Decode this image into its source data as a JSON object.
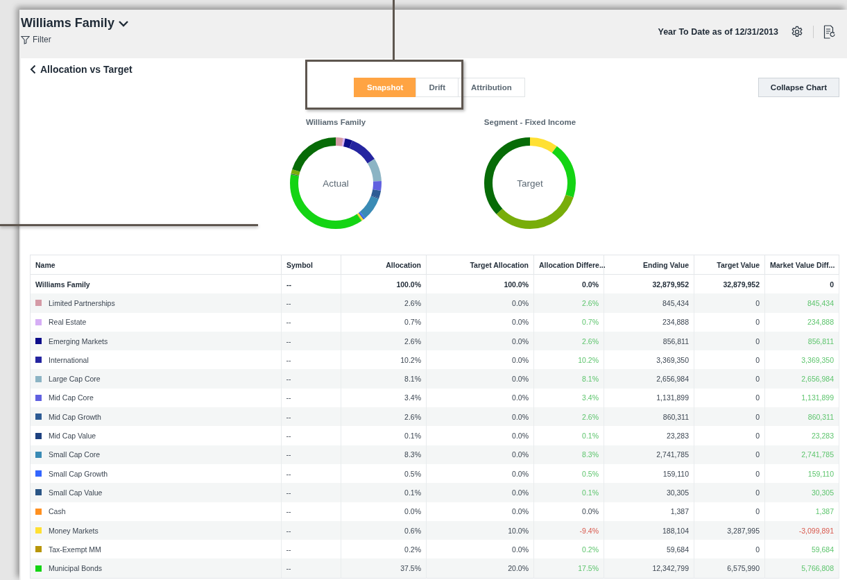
{
  "header": {
    "title": "Williams Family",
    "filter": "Filter",
    "period": "Year To Date as of 12/31/2013"
  },
  "panel": {
    "back": "Allocation vs Target",
    "collapse": "Collapse Chart"
  },
  "tabs": [
    {
      "label": "Snapshot",
      "selected": true
    },
    {
      "label": "Drift",
      "selected": false
    },
    {
      "label": "Attribution",
      "selected": false
    }
  ],
  "donuts": [
    {
      "title": "Williams Family",
      "center": "Actual"
    },
    {
      "title": "Segment - Fixed Income",
      "center": "Target"
    }
  ],
  "table": {
    "columns": [
      "Name",
      "Symbol",
      "Allocation",
      "Target Allocation",
      "Allocation Differe...",
      "Ending Value",
      "Target Value",
      "Market Value Diff..."
    ],
    "total": {
      "name": "Williams Family",
      "symbol": "--",
      "allocation": "100.0%",
      "target_allocation": "100.0%",
      "allocation_diff": "0.0%",
      "ending_value": "32,879,952",
      "target_value": "32,879,952",
      "market_value_diff": "0"
    },
    "rows": [
      {
        "name": "Limited Partnerships",
        "color": "#d49aa6",
        "symbol": "--",
        "allocation": "2.6%",
        "target_allocation": "0.0%",
        "allocation_diff": "2.6%",
        "diff_gain": true,
        "diff_loss": false,
        "ending_value": "845,434",
        "target_value": "0",
        "market_value_diff": "845,434",
        "mv_gain": true,
        "mv_loss": false
      },
      {
        "name": "Real Estate",
        "color": "#d6aef5",
        "symbol": "--",
        "allocation": "0.7%",
        "target_allocation": "0.0%",
        "allocation_diff": "0.7%",
        "diff_gain": true,
        "diff_loss": false,
        "ending_value": "234,888",
        "target_value": "0",
        "market_value_diff": "234,888",
        "mv_gain": true,
        "mv_loss": false
      },
      {
        "name": "Emerging Markets",
        "color": "#0d0d8a",
        "symbol": "--",
        "allocation": "2.6%",
        "target_allocation": "0.0%",
        "allocation_diff": "2.6%",
        "diff_gain": true,
        "diff_loss": false,
        "ending_value": "856,811",
        "target_value": "0",
        "market_value_diff": "856,811",
        "mv_gain": true,
        "mv_loss": false
      },
      {
        "name": "International",
        "color": "#2525a0",
        "symbol": "--",
        "allocation": "10.2%",
        "target_allocation": "0.0%",
        "allocation_diff": "10.2%",
        "diff_gain": true,
        "diff_loss": false,
        "ending_value": "3,369,350",
        "target_value": "0",
        "market_value_diff": "3,369,350",
        "mv_gain": true,
        "mv_loss": false
      },
      {
        "name": "Large Cap Core",
        "color": "#8cb4c4",
        "symbol": "--",
        "allocation": "8.1%",
        "target_allocation": "0.0%",
        "allocation_diff": "8.1%",
        "diff_gain": true,
        "diff_loss": false,
        "ending_value": "2,656,984",
        "target_value": "0",
        "market_value_diff": "2,656,984",
        "mv_gain": true,
        "mv_loss": false
      },
      {
        "name": "Mid Cap Core",
        "color": "#6161e0",
        "symbol": "--",
        "allocation": "3.4%",
        "target_allocation": "0.0%",
        "allocation_diff": "3.4%",
        "diff_gain": true,
        "diff_loss": false,
        "ending_value": "1,131,899",
        "target_value": "0",
        "market_value_diff": "1,131,899",
        "mv_gain": true,
        "mv_loss": false
      },
      {
        "name": "Mid Cap Growth",
        "color": "#2d5b94",
        "symbol": "--",
        "allocation": "2.6%",
        "target_allocation": "0.0%",
        "allocation_diff": "2.6%",
        "diff_gain": true,
        "diff_loss": false,
        "ending_value": "860,311",
        "target_value": "0",
        "market_value_diff": "860,311",
        "mv_gain": true,
        "mv_loss": false
      },
      {
        "name": "Mid Cap Value",
        "color": "#1e4280",
        "symbol": "--",
        "allocation": "0.1%",
        "target_allocation": "0.0%",
        "allocation_diff": "0.1%",
        "diff_gain": true,
        "diff_loss": false,
        "ending_value": "23,283",
        "target_value": "0",
        "market_value_diff": "23,283",
        "mv_gain": true,
        "mv_loss": false
      },
      {
        "name": "Small Cap Core",
        "color": "#3a8bb5",
        "symbol": "--",
        "allocation": "8.3%",
        "target_allocation": "0.0%",
        "allocation_diff": "8.3%",
        "diff_gain": true,
        "diff_loss": false,
        "ending_value": "2,741,785",
        "target_value": "0",
        "market_value_diff": "2,741,785",
        "mv_gain": true,
        "mv_loss": false
      },
      {
        "name": "Small Cap Growth",
        "color": "#3366ff",
        "symbol": "--",
        "allocation": "0.5%",
        "target_allocation": "0.0%",
        "allocation_diff": "0.5%",
        "diff_gain": true,
        "diff_loss": false,
        "ending_value": "159,110",
        "target_value": "0",
        "market_value_diff": "159,110",
        "mv_gain": true,
        "mv_loss": false
      },
      {
        "name": "Small Cap Value",
        "color": "#2a5585",
        "symbol": "--",
        "allocation": "0.1%",
        "target_allocation": "0.0%",
        "allocation_diff": "0.1%",
        "diff_gain": true,
        "diff_loss": false,
        "ending_value": "30,305",
        "target_value": "0",
        "market_value_diff": "30,305",
        "mv_gain": true,
        "mv_loss": false
      },
      {
        "name": "Cash",
        "color": "#ff9020",
        "symbol": "--",
        "allocation": "0.0%",
        "target_allocation": "0.0%",
        "allocation_diff": "0.0%",
        "diff_gain": false,
        "diff_loss": false,
        "ending_value": "1,387",
        "target_value": "0",
        "market_value_diff": "1,387",
        "mv_gain": true,
        "mv_loss": false
      },
      {
        "name": "Money Markets",
        "color": "#ffe033",
        "symbol": "--",
        "allocation": "0.6%",
        "target_allocation": "10.0%",
        "allocation_diff": "-9.4%",
        "diff_gain": false,
        "diff_loss": true,
        "ending_value": "188,104",
        "target_value": "3,287,995",
        "market_value_diff": "-3,099,891",
        "mv_gain": false,
        "mv_loss": true
      },
      {
        "name": "Tax-Exempt MM",
        "color": "#b8960a",
        "symbol": "--",
        "allocation": "0.2%",
        "target_allocation": "0.0%",
        "allocation_diff": "0.2%",
        "diff_gain": true,
        "diff_loss": false,
        "ending_value": "59,684",
        "target_value": "0",
        "market_value_diff": "59,684",
        "mv_gain": true,
        "mv_loss": false
      },
      {
        "name": "Municipal Bonds",
        "color": "#14d414",
        "symbol": "--",
        "allocation": "37.5%",
        "target_allocation": "20.0%",
        "allocation_diff": "17.5%",
        "diff_gain": true,
        "diff_loss": false,
        "ending_value": "12,342,799",
        "target_value": "6,575,990",
        "market_value_diff": "5,766,808",
        "mv_gain": true,
        "mv_loss": false
      }
    ]
  }
}
